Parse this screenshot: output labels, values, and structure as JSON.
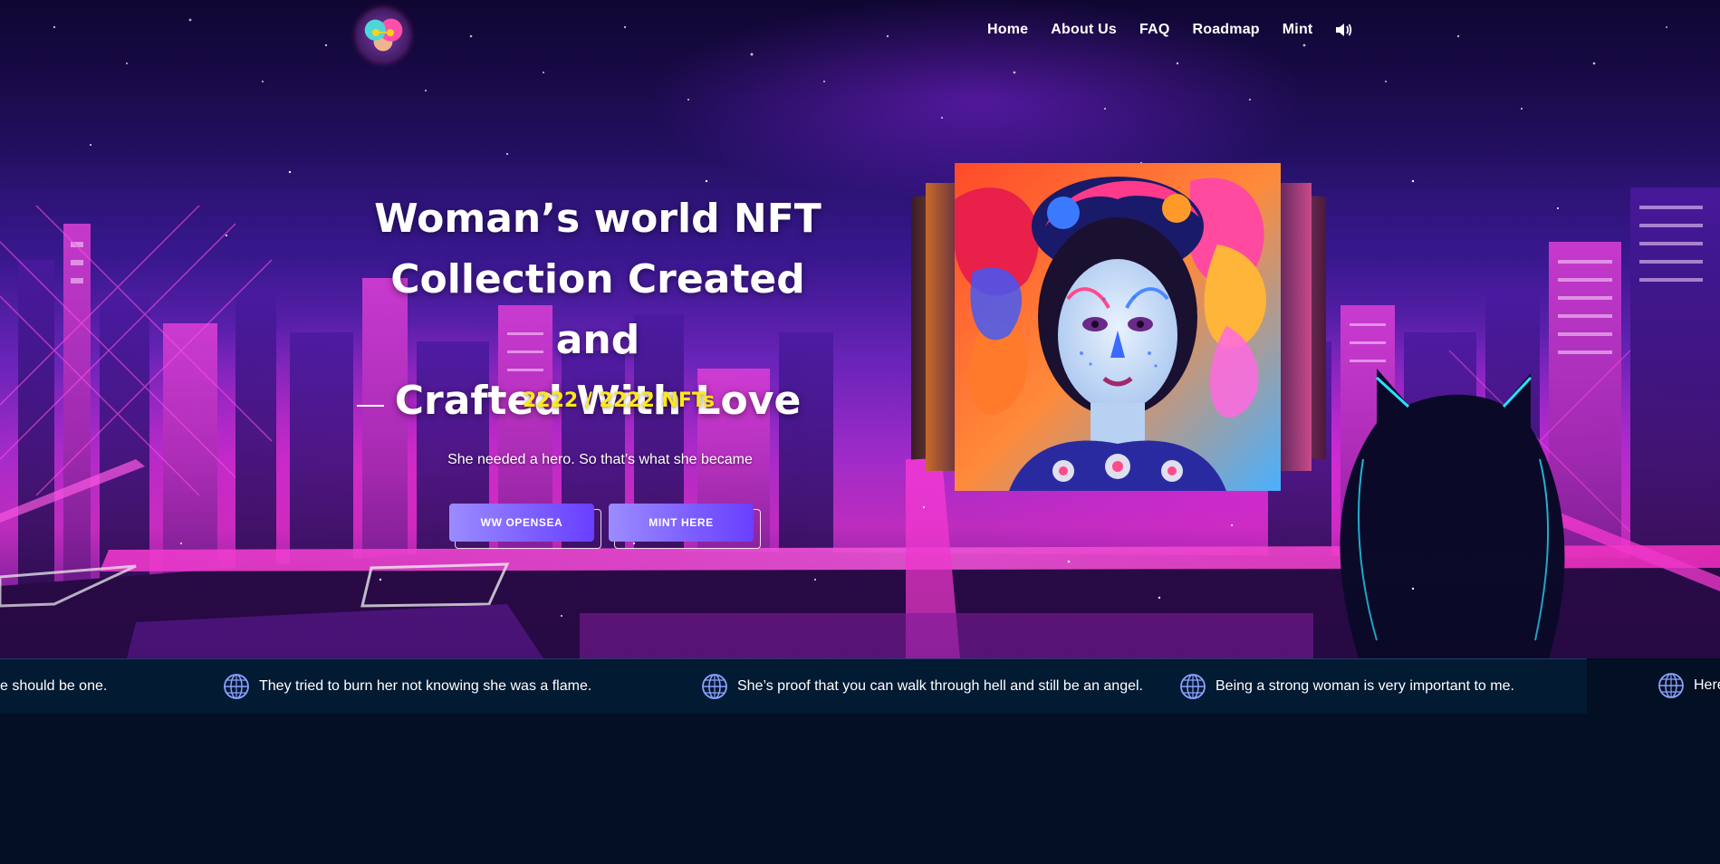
{
  "nav": {
    "items": [
      {
        "label": "Home"
      },
      {
        "label": "About Us"
      },
      {
        "label": "FAQ"
      },
      {
        "label": "Roadmap"
      },
      {
        "label": "Mint"
      }
    ],
    "sound_icon": "speaker-icon"
  },
  "hero": {
    "headline_lines": [
      "Woman’s world NFT",
      "Collection Created and",
      "Crafted With Love"
    ],
    "nft_count": "2222 / 2222 NFTs",
    "tagline": "She needed a hero. So that’s what she became",
    "buttons": {
      "opensea": "WW OPENSEA",
      "mint": "MINT HERE"
    }
  },
  "ticker": {
    "icon": "globe-icon",
    "items": [
      "e should be one.",
      "They tried to burn her not knowing she was a flame.",
      "She’s proof that you can walk through hell and still be an angel.",
      "Being a strong woman is very important to me.",
      "Here"
    ]
  },
  "colors": {
    "accent_yellow": "#ffe81a",
    "button_purple": "#7b5cff",
    "page_bg": "#030f22",
    "ticker_bg": "#031a33"
  }
}
